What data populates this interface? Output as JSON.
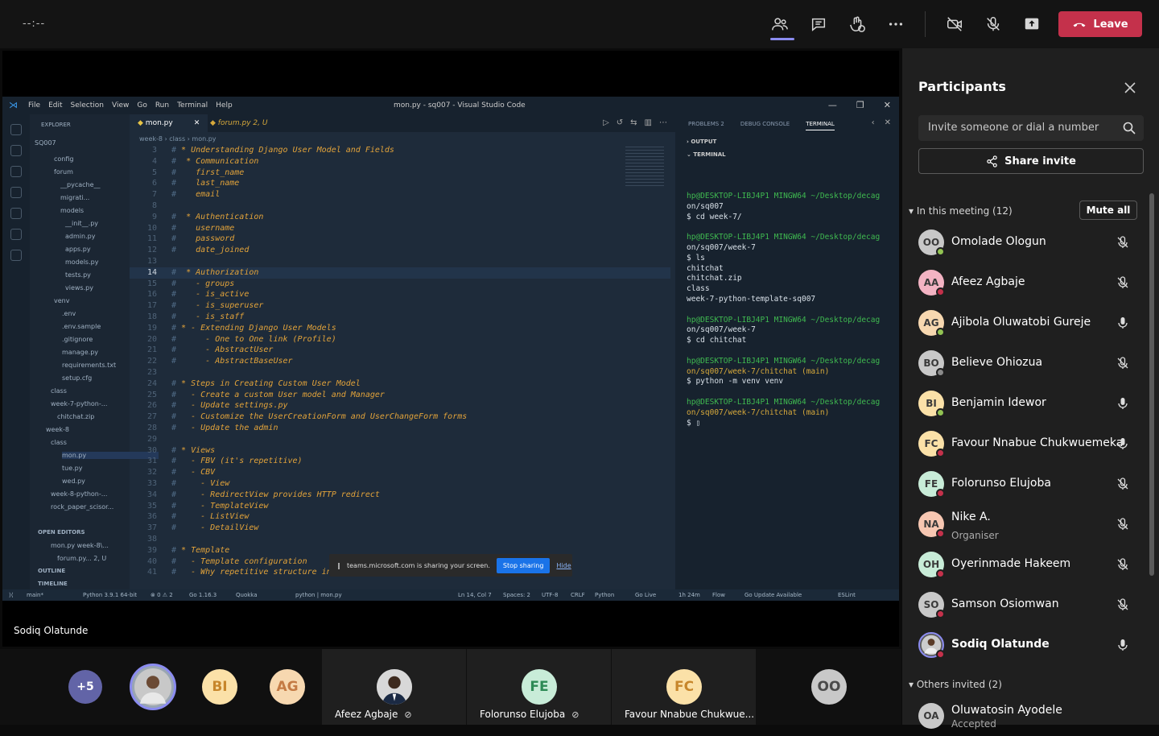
{
  "topbar": {
    "timer": "--:--",
    "leave_label": "Leave"
  },
  "vscode": {
    "menu": [
      "File",
      "Edit",
      "Selection",
      "View",
      "Go",
      "Run",
      "Terminal",
      "Help"
    ],
    "title": "mon.py - sq007 - Visual Studio Code",
    "explorer_label": "EXPLORER",
    "tabs": [
      "mon.py",
      "forum.py 2, U"
    ],
    "breadcrumb": "week-8 › class › mon.py",
    "explorer_rows": [
      "SQ007",
      "config",
      "forum",
      "__pycache__",
      "migrati...",
      "models",
      "__init__.py",
      "admin.py",
      "apps.py",
      "models.py",
      "tests.py",
      "views.py",
      "venv",
      ".env",
      ".env.sample",
      ".gitignore",
      "manage.py",
      "requirements.txt",
      "setup.cfg",
      "class",
      "week-7-python-...",
      "chitchat.zip",
      "week-8",
      "class",
      "mon.py",
      "tue.py",
      "wed.py",
      "week-8-python-...",
      "rock_paper_scisor...",
      "OPEN EDITORS",
      "mon.py week-8\\...",
      "forum.py... 2, U",
      "OUTLINE",
      "TIMELINE"
    ],
    "code_lines": [
      {
        "n": "3",
        "t": "# * Understanding Django User Model and Fields"
      },
      {
        "n": "4",
        "t": "#  * Communication"
      },
      {
        "n": "5",
        "t": "#    first_name"
      },
      {
        "n": "6",
        "t": "#    last_name"
      },
      {
        "n": "7",
        "t": "#    email"
      },
      {
        "n": "8",
        "t": ""
      },
      {
        "n": "9",
        "t": "#  * Authentication"
      },
      {
        "n": "10",
        "t": "#    username"
      },
      {
        "n": "11",
        "t": "#    password"
      },
      {
        "n": "12",
        "t": "#    date_joined"
      },
      {
        "n": "13",
        "t": ""
      },
      {
        "n": "14",
        "t": "#  * Authorization"
      },
      {
        "n": "15",
        "t": "#    - groups"
      },
      {
        "n": "16",
        "t": "#    - is_active"
      },
      {
        "n": "17",
        "t": "#    - is_superuser"
      },
      {
        "n": "18",
        "t": "#    - is_staff"
      },
      {
        "n": "19",
        "t": "# * - Extending Django User Models"
      },
      {
        "n": "20",
        "t": "#      - One to One link (Profile)"
      },
      {
        "n": "21",
        "t": "#      - AbstractUser"
      },
      {
        "n": "22",
        "t": "#      - AbstractBaseUser"
      },
      {
        "n": "23",
        "t": ""
      },
      {
        "n": "24",
        "t": "# * Steps in Creating Custom User Model"
      },
      {
        "n": "25",
        "t": "#   - Create a custom User model and Manager"
      },
      {
        "n": "26",
        "t": "#   - Update settings.py"
      },
      {
        "n": "27",
        "t": "#   - Customize the UserCreationForm and UserChangeForm forms"
      },
      {
        "n": "28",
        "t": "#   - Update the admin"
      },
      {
        "n": "29",
        "t": ""
      },
      {
        "n": "30",
        "t": "# * Views"
      },
      {
        "n": "31",
        "t": "#   - FBV (it's repetitive)"
      },
      {
        "n": "32",
        "t": "#   - CBV"
      },
      {
        "n": "33",
        "t": "#     - View"
      },
      {
        "n": "34",
        "t": "#     - RedirectView provides HTTP redirect"
      },
      {
        "n": "35",
        "t": "#     - TemplateView"
      },
      {
        "n": "36",
        "t": "#     - ListView"
      },
      {
        "n": "37",
        "t": "#     - DetailView"
      },
      {
        "n": "38",
        "t": ""
      },
      {
        "n": "39",
        "t": "# * Template"
      },
      {
        "n": "40",
        "t": "#   - Template configuration"
      },
      {
        "n": "41",
        "t": "#   - Why repetitive structure in Django default template settings?"
      }
    ],
    "panel_tabs": [
      "PROBLEMS 2",
      "DEBUG CONSOLE",
      "TERMINAL"
    ],
    "output_label": "OUTPUT",
    "terminal_label": "TERMINAL",
    "terminal_text": "hp@DESKTOP-LIBJ4P1 MINGW64 ~/Desktop/decag\non/sq007\n$ cd week-7/\n\nhp@DESKTOP-LIBJ4P1 MINGW64 ~/Desktop/decag\non/sq007/week-7\n$ ls\nchitchat\nchitchat.zip\nclass\nweek-7-python-template-sq007\n\nhp@DESKTOP-LIBJ4P1 MINGW64 ~/Desktop/decag\non/sq007/week-7\n$ cd chitchat\n\nhp@DESKTOP-LIBJ4P1 MINGW64 ~/Desktop/decag\non/sq007/week-7/chitchat (main)\n$ python -m venv venv\n\nhp@DESKTOP-LIBJ4P1 MINGW64 ~/Desktop/decag\non/sq007/week-7/chitchat (main)\n$ ▯",
    "status": [
      "main*",
      "Python 3.9.1 64-bit",
      "⊗ 0 ⚠ 2",
      "Go 1.16.3",
      "Quokka",
      "python | mon.py",
      "Ln 14, Col 7",
      "Spaces: 2",
      "UTF-8",
      "CRLF",
      "Python",
      "Go Live",
      "1h 24m",
      "Flow",
      "Go Update Available",
      "ESLint"
    ],
    "sharebar": {
      "msg": "teams.microsoft.com is sharing your screen.",
      "stop": "Stop sharing",
      "hide": "Hide"
    }
  },
  "presenter_name": "Sodiq Olatunde",
  "strip": {
    "more": "+5",
    "bi": "BI",
    "ag": "AG",
    "tile1_name": "Afeez Agbaje",
    "tile2_initials": "FE",
    "tile2_name": "Folorunso Elujoba",
    "tile3_initials": "FC",
    "tile3_name": "Favour Nnabue Chukwue...",
    "oo": "OO"
  },
  "participants": {
    "title": "Participants",
    "invite_placeholder": "Invite someone or dial a number",
    "share_invite": "Share invite",
    "in_meeting": "In this meeting (12)",
    "mute_all": "Mute all",
    "others_invited": "Others invited (2)",
    "list": [
      {
        "initials": "OO",
        "name": "Omolade Ologun",
        "role": "",
        "mic": "muted",
        "color": "#c8c8c8",
        "status": "#92c353"
      },
      {
        "initials": "AA",
        "name": "Afeez Agbaje",
        "role": "",
        "mic": "muted",
        "color": "#f3b3c3",
        "status": "#c4314b"
      },
      {
        "initials": "AG",
        "name": "Ajibola Oluwatobi Gureje",
        "role": "",
        "mic": "on",
        "color": "#f7d8b0",
        "status": "#92c353"
      },
      {
        "initials": "BO",
        "name": "Believe Ohiozua",
        "role": "",
        "mic": "muted",
        "color": "#c8c8c8",
        "status": "#8a8a8a"
      },
      {
        "initials": "BI",
        "name": "Benjamin Idewor",
        "role": "",
        "mic": "on",
        "color": "#fbe1a8",
        "status": "#92c353"
      },
      {
        "initials": "FC",
        "name": "Favour Nnabue Chukwuemeka",
        "role": "",
        "mic": "on",
        "color": "#fbe1a8",
        "status": "#c4314b"
      },
      {
        "initials": "FE",
        "name": "Folorunso Elujoba",
        "role": "",
        "mic": "muted",
        "color": "#c8ecd8",
        "status": "#c4314b"
      },
      {
        "initials": "NA",
        "name": "Nike A.",
        "role": "Organiser",
        "mic": "muted",
        "color": "#f7c7b2",
        "status": "#c4314b"
      },
      {
        "initials": "OH",
        "name": "Oyerinmade Hakeem",
        "role": "",
        "mic": "muted",
        "color": "#c8ecd8",
        "status": "#c4314b"
      },
      {
        "initials": "SO",
        "name": "Samson Osiomwan",
        "role": "",
        "mic": "muted",
        "color": "#c8c8c8",
        "status": "#c4314b"
      },
      {
        "initials": "",
        "name": "Sodiq Olatunde",
        "role": "",
        "mic": "on",
        "color": "#5a5a5a",
        "status": "#c4314b"
      }
    ],
    "invited": [
      {
        "initials": "OA",
        "name": "Oluwatosin Ayodele",
        "role": "Accepted"
      }
    ]
  }
}
